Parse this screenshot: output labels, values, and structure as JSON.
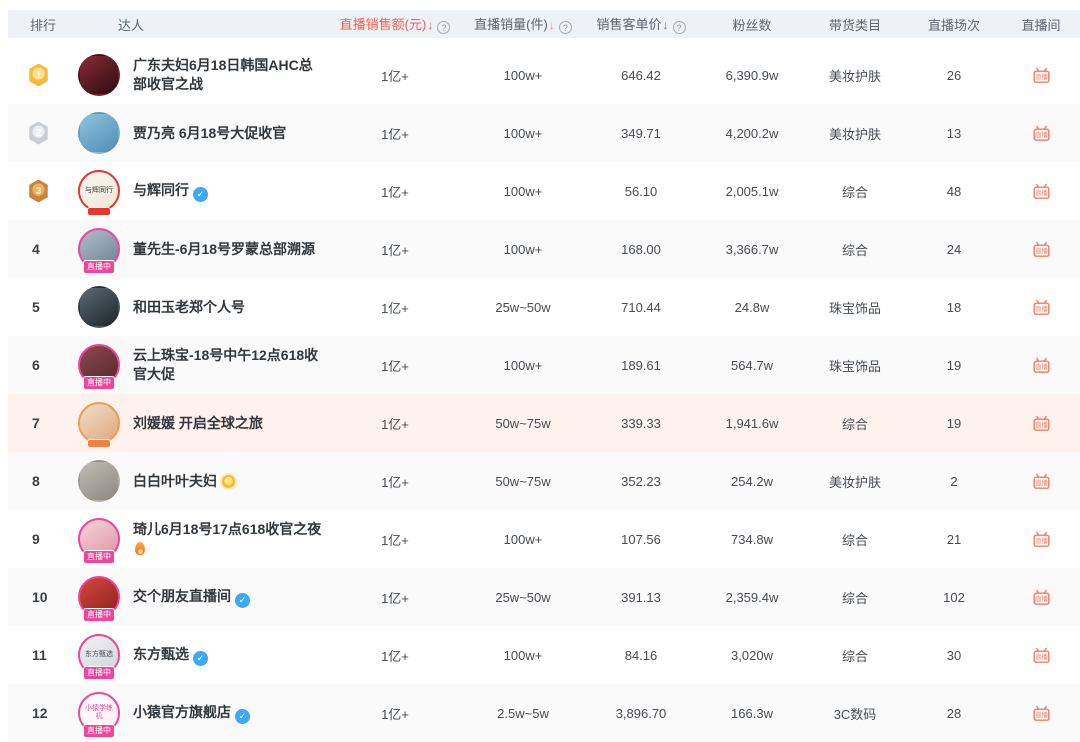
{
  "table": {
    "columns": [
      {
        "label": "排行"
      },
      {
        "label": "达人"
      },
      {
        "label": "直播销售额(元)",
        "sort": "desc",
        "help": true,
        "active": true
      },
      {
        "label": "直播销量(件)",
        "sort": "desc",
        "help": true
      },
      {
        "label": "销售客单价",
        "sort": "desc",
        "help": true
      },
      {
        "label": "粉丝数"
      },
      {
        "label": "带货类目"
      },
      {
        "label": "直播场次"
      },
      {
        "label": "直播间"
      }
    ],
    "sort_arrow": "↓",
    "help_glyph": "?",
    "verified_glyph": "✓",
    "live_room_icon_label": "直播",
    "rows": [
      {
        "rank": "1",
        "medal": "gold",
        "name": "广东夫妇6月18日韩国AHC总部收官之战",
        "verified": false,
        "suffix": null,
        "sales": "1亿+",
        "volume": "100w+",
        "price": "646.42",
        "fans": "6,390.9w",
        "category": "美妆护肤",
        "sessions": "26",
        "avatar": {
          "bg": [
            "#8a2a34",
            "#2b0d12"
          ],
          "ring": null,
          "text": null,
          "badge": null
        }
      },
      {
        "rank": "2",
        "medal": "silver",
        "name": "贾乃亮 6月18号大促收官",
        "verified": false,
        "suffix": null,
        "sales": "1亿+",
        "volume": "100w+",
        "price": "349.71",
        "fans": "4,200.2w",
        "category": "美妆护肤",
        "sessions": "13",
        "avatar": {
          "bg": [
            "#8fc3e0",
            "#4f8db4"
          ],
          "ring": null,
          "text": null,
          "badge": null
        }
      },
      {
        "rank": "3",
        "medal": "bronze",
        "name": "与辉同行",
        "verified": true,
        "suffix": null,
        "sales": "1亿+",
        "volume": "100w+",
        "price": "56.10",
        "fans": "2,005.1w",
        "category": "综合",
        "sessions": "48",
        "avatar": {
          "bg": [
            "#faf6ee",
            "#efe8da"
          ],
          "ring": "#e8352e",
          "text": "与辉同行",
          "text_color": "#3a3530",
          "badge": {
            "text": "",
            "color": "#e8352e"
          }
        }
      },
      {
        "rank": "4",
        "medal": null,
        "name": "董先生-6月18号罗蒙总部溯源",
        "verified": false,
        "suffix": null,
        "sales": "1亿+",
        "volume": "100w+",
        "price": "168.00",
        "fans": "3,366.7w",
        "category": "综合",
        "sessions": "24",
        "avatar": {
          "bg": [
            "#aebecb",
            "#6e8090"
          ],
          "ring": "#f0459a",
          "text": null,
          "badge": {
            "text": "直播中",
            "color": "#f0459a"
          }
        }
      },
      {
        "rank": "5",
        "medal": null,
        "name": "和田玉老郑个人号",
        "verified": false,
        "suffix": null,
        "sales": "1亿+",
        "volume": "25w~50w",
        "price": "710.44",
        "fans": "24.8w",
        "category": "珠宝饰品",
        "sessions": "18",
        "avatar": {
          "bg": [
            "#5a6b74",
            "#1d2429"
          ],
          "ring": null,
          "text": null,
          "badge": null
        }
      },
      {
        "rank": "6",
        "medal": null,
        "name": "云上珠宝-18号中午12点618收官大促",
        "verified": false,
        "suffix": null,
        "sales": "1亿+",
        "volume": "100w+",
        "price": "189.61",
        "fans": "564.7w",
        "category": "珠宝饰品",
        "sessions": "19",
        "avatar": {
          "bg": [
            "#8c4a50",
            "#54262b"
          ],
          "ring": "#f0459a",
          "text": null,
          "badge": {
            "text": "直播中",
            "color": "#f0459a"
          }
        }
      },
      {
        "rank": "7",
        "medal": null,
        "name": "刘媛媛 开启全球之旅",
        "verified": false,
        "suffix": null,
        "highlight": true,
        "sales": "1亿+",
        "volume": "50w~75w",
        "price": "339.33",
        "fans": "1,941.6w",
        "category": "综合",
        "sessions": "19",
        "avatar": {
          "bg": [
            "#f4dcc9",
            "#dba87f"
          ],
          "ring": "#f59a4e",
          "text": null,
          "badge": {
            "text": "",
            "color": "#f5813e"
          }
        }
      },
      {
        "rank": "8",
        "medal": null,
        "name": "白白叶叶夫妇",
        "verified": false,
        "suffix": "sun",
        "sales": "1亿+",
        "volume": "50w~75w",
        "price": "352.23",
        "fans": "254.2w",
        "category": "美妆护肤",
        "sessions": "2",
        "avatar": {
          "bg": [
            "#c2bcb6",
            "#8d8781"
          ],
          "ring": null,
          "text": null,
          "badge": null
        }
      },
      {
        "rank": "9",
        "medal": null,
        "name": "琦儿6月18号17点618收官之夜",
        "verified": false,
        "suffix": "fire",
        "sales": "1亿+",
        "volume": "100w+",
        "price": "107.56",
        "fans": "734.8w",
        "category": "综合",
        "sessions": "21",
        "avatar": {
          "bg": [
            "#f6d4da",
            "#dd93a5"
          ],
          "ring": "#f0459a",
          "text": null,
          "badge": {
            "text": "直播中",
            "color": "#f0459a"
          }
        }
      },
      {
        "rank": "10",
        "medal": null,
        "name": "交个朋友直播间",
        "verified": true,
        "suffix": null,
        "sales": "1亿+",
        "volume": "25w~50w",
        "price": "391.13",
        "fans": "2,359.4w",
        "category": "综合",
        "sessions": "102",
        "avatar": {
          "bg": [
            "#cf4a3e",
            "#8f1f1a"
          ],
          "ring": "#f0459a",
          "text": null,
          "badge": {
            "text": "直播中",
            "color": "#f0459a"
          }
        }
      },
      {
        "rank": "11",
        "medal": null,
        "name": "东方甄选",
        "verified": true,
        "suffix": null,
        "sales": "1亿+",
        "volume": "100w+",
        "price": "84.16",
        "fans": "3,020w",
        "category": "综合",
        "sessions": "30",
        "avatar": {
          "bg": [
            "#f2f4f6",
            "#ccd3d9"
          ],
          "ring": "#f0459a",
          "text": "东方甄选",
          "text_color": "#444a50",
          "badge": {
            "text": "直播中",
            "color": "#f0459a"
          }
        }
      },
      {
        "rank": "12",
        "medal": null,
        "name": "小猿官方旗舰店",
        "verified": true,
        "suffix": null,
        "sales": "1亿+",
        "volume": "2.5w~5w",
        "price": "3,896.70",
        "fans": "166.3w",
        "category": "3C数码",
        "sessions": "28",
        "avatar": {
          "bg": [
            "#ffffff",
            "#fdeef5"
          ],
          "ring": "#f0459a",
          "text": "小猿学练机",
          "text_color": "#f0459a",
          "badge": {
            "text": "直播中",
            "color": "#f0459a"
          }
        }
      }
    ]
  },
  "colors": {
    "active_sort": "#f6604e",
    "header_bg": "#eef1f5",
    "row_zebra": "#fafafa",
    "row_highlight": "#fdf2ed",
    "live_icon": "#f87a5f",
    "verified_blue": "#3da8f5",
    "ring_pink": "#f0459a"
  }
}
